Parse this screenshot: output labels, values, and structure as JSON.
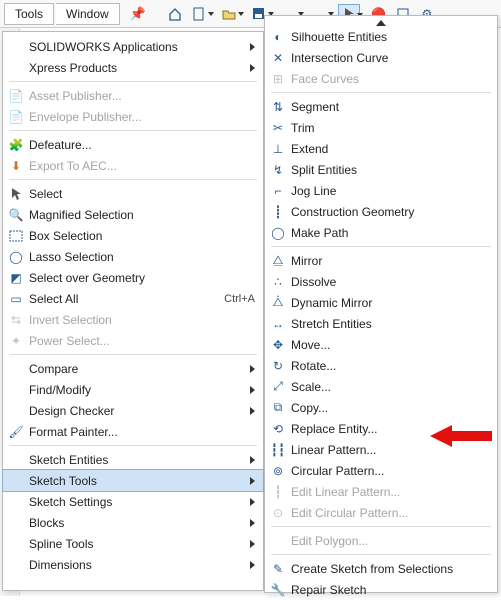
{
  "menubar": {
    "tab_tools": "Tools",
    "tab_window": "Window"
  },
  "tools_menu": {
    "solidworks_apps": "SOLIDWORKS Applications",
    "xpress": "Xpress Products",
    "asset_pub": "Asset Publisher...",
    "envelope_pub": "Envelope Publisher...",
    "defeature": "Defeature...",
    "export_aec": "Export To AEC...",
    "select": "Select",
    "mag_sel": "Magnified Selection",
    "box_sel": "Box Selection",
    "lasso_sel": "Lasso Selection",
    "sel_over_geom": "Select over Geometry",
    "select_all": "Select All",
    "select_all_shortcut": "Ctrl+A",
    "invert_sel": "Invert Selection",
    "power_sel": "Power Select...",
    "compare": "Compare",
    "find_modify": "Find/Modify",
    "design_checker": "Design Checker",
    "format_painter": "Format Painter...",
    "sketch_entities": "Sketch Entities",
    "sketch_tools": "Sketch Tools",
    "sketch_settings": "Sketch Settings",
    "blocks": "Blocks",
    "spline_tools": "Spline Tools",
    "dimensions": "Dimensions"
  },
  "submenu": {
    "silhouette": "Silhouette Entities",
    "intersection": "Intersection Curve",
    "face_curves": "Face Curves",
    "segment": "Segment",
    "trim": "Trim",
    "extend": "Extend",
    "split_ent": "Split Entities",
    "jog_line": "Jog Line",
    "construction_geom": "Construction Geometry",
    "make_path": "Make Path",
    "mirror": "Mirror",
    "dissolve": "Dissolve",
    "dyn_mirror": "Dynamic Mirror",
    "stretch": "Stretch Entities",
    "move": "Move...",
    "rotate": "Rotate...",
    "scale": "Scale...",
    "copy": "Copy...",
    "replace_ent": "Replace Entity...",
    "linear_pattern": "Linear Pattern...",
    "circular_pattern": "Circular Pattern...",
    "edit_linear": "Edit Linear Pattern...",
    "edit_circular": "Edit Circular Pattern...",
    "edit_polygon": "Edit Polygon...",
    "create_sketch_sel": "Create Sketch from Selections",
    "repair_sketch": "Repair Sketch"
  }
}
